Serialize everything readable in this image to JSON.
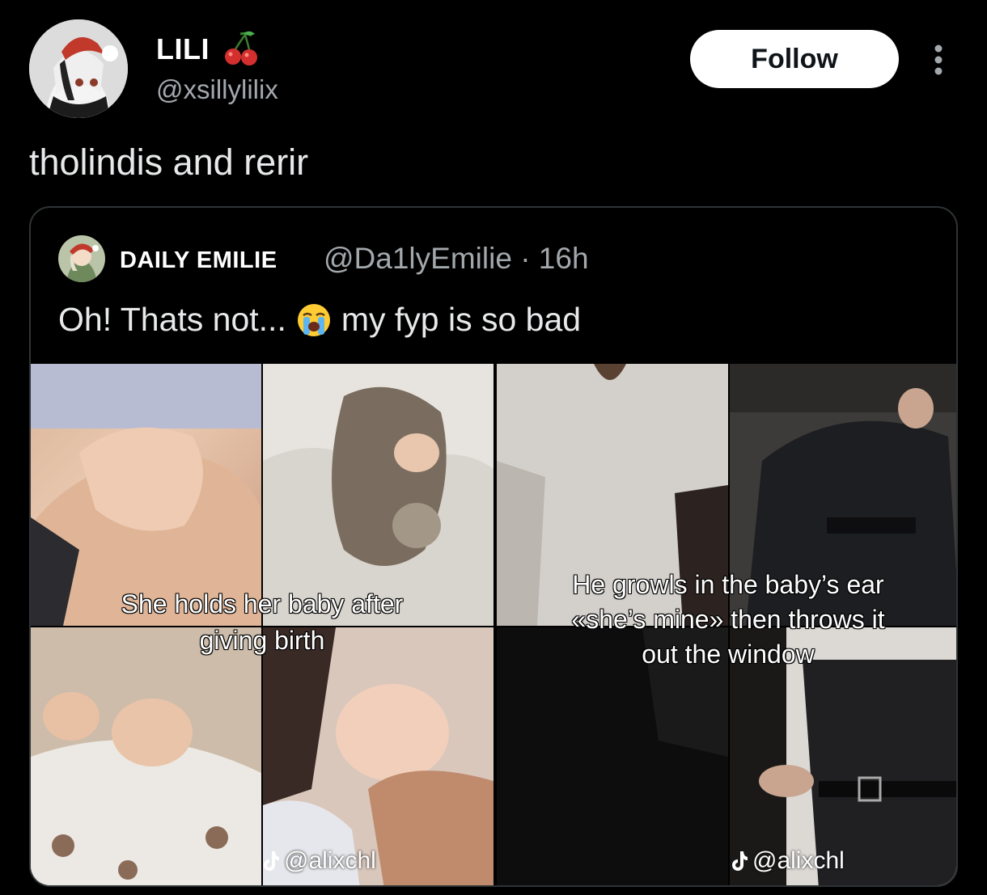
{
  "tweet": {
    "author": {
      "display_name": "LILI",
      "name_emoji": "cherry-icon",
      "handle": "@xsillylilix"
    },
    "follow_label": "Follow",
    "text": "tholindis and rerir"
  },
  "quote": {
    "author": {
      "display_name": "DAILY EMILIE",
      "handle": "@Da1lyEmilie",
      "separator": "·",
      "time": "16h"
    },
    "text_before": "Oh! Thats not...",
    "emoji": "loudly-crying-face-icon",
    "text_after": "my fyp is so bad",
    "media": {
      "left_caption_line1": "She holds her baby after",
      "left_caption_line2": "giving birth",
      "right_caption_line1": "He growls in the baby’s ear",
      "right_caption_line2": "«she’s mine» then throws it",
      "right_caption_line3": "out the window",
      "watermark_left": "@alixchl",
      "watermark_right": "@alixchl"
    }
  },
  "colors": {
    "background": "#000000",
    "text_primary": "#e7e9ea",
    "text_secondary": "#a3a8ad",
    "border": "#2f3336",
    "follow_bg": "#ffffff"
  }
}
